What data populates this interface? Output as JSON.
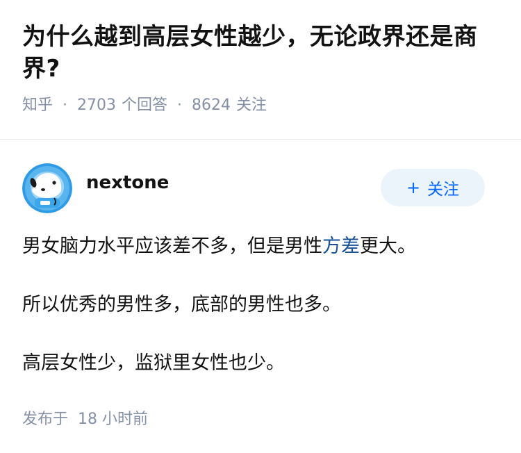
{
  "question": {
    "title": "为什么越到高层女性越少，无论政界还是商界?",
    "source": "知乎",
    "answer_count": "2703",
    "answer_label": "个回答",
    "follower_count": "8624",
    "follower_label": "关注"
  },
  "answer": {
    "author": "nextone",
    "follow_button": "关注",
    "paragraphs": [
      {
        "before": "男女脑力水平应该差不多，但是男性",
        "link": "方差",
        "after": "更大。"
      },
      {
        "text": "所以优秀的男性多，底部的男性也多。"
      },
      {
        "text": "高层女性少，监狱里女性也少。"
      }
    ],
    "published_label": "发布于",
    "published_time": "18 小时前"
  },
  "colors": {
    "meta_gray": "#8590a6",
    "link_blue": "#175199",
    "accent_blue": "#0066ff",
    "button_bg": "#ebf3fb"
  },
  "icons": {
    "separator": "dot",
    "follow_plus": "plus-icon",
    "avatar": "astronaut-dog-avatar"
  }
}
